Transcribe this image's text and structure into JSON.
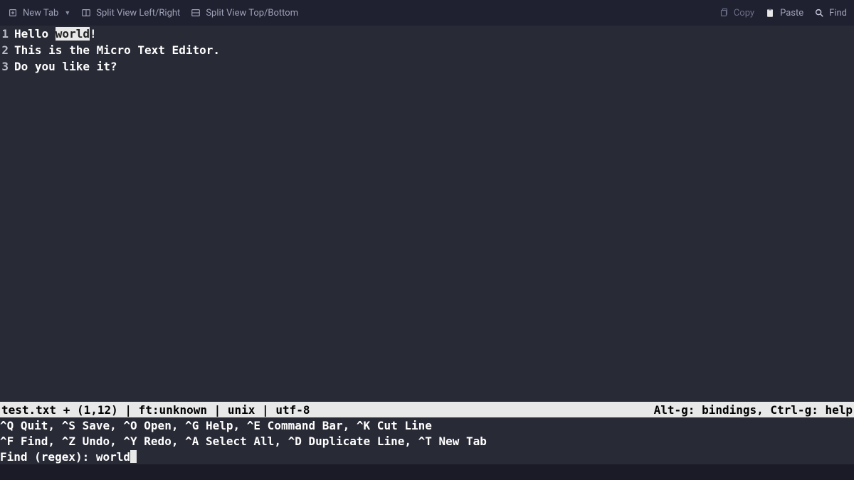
{
  "toolbar": {
    "left": [
      {
        "label": "New Tab",
        "icon": "new-tab-icon",
        "has_chevron": true
      },
      {
        "label": "Split View Left/Right",
        "icon": "split-lr-icon",
        "has_chevron": false
      },
      {
        "label": "Split View Top/Bottom",
        "icon": "split-tb-icon",
        "has_chevron": false
      }
    ],
    "right": [
      {
        "label": "Copy",
        "icon": "copy-icon",
        "dim": true
      },
      {
        "label": "Paste",
        "icon": "paste-icon",
        "dim": false
      },
      {
        "label": "Find",
        "icon": "find-icon",
        "dim": false
      }
    ]
  },
  "editor": {
    "lines": [
      {
        "num": "1",
        "pre": "Hello ",
        "hl": "world",
        "post": "!"
      },
      {
        "num": "2",
        "pre": "This is the Micro Text Editor.",
        "hl": "",
        "post": ""
      },
      {
        "num": "3",
        "pre": "Do you like it?",
        "hl": "",
        "post": ""
      }
    ]
  },
  "statusbar": {
    "left": "test.txt + (1,12) | ft:unknown | unix | utf-8",
    "right": "Alt-g: bindings, Ctrl-g: help"
  },
  "hints": {
    "line1": "^Q Quit, ^S Save, ^O Open, ^G Help, ^E Command Bar, ^K Cut Line",
    "line2": "^F Find, ^Z Undo, ^Y Redo, ^A Select All, ^D Duplicate Line, ^T New Tab"
  },
  "prompt": {
    "label": "Find (regex): ",
    "value": "world"
  }
}
